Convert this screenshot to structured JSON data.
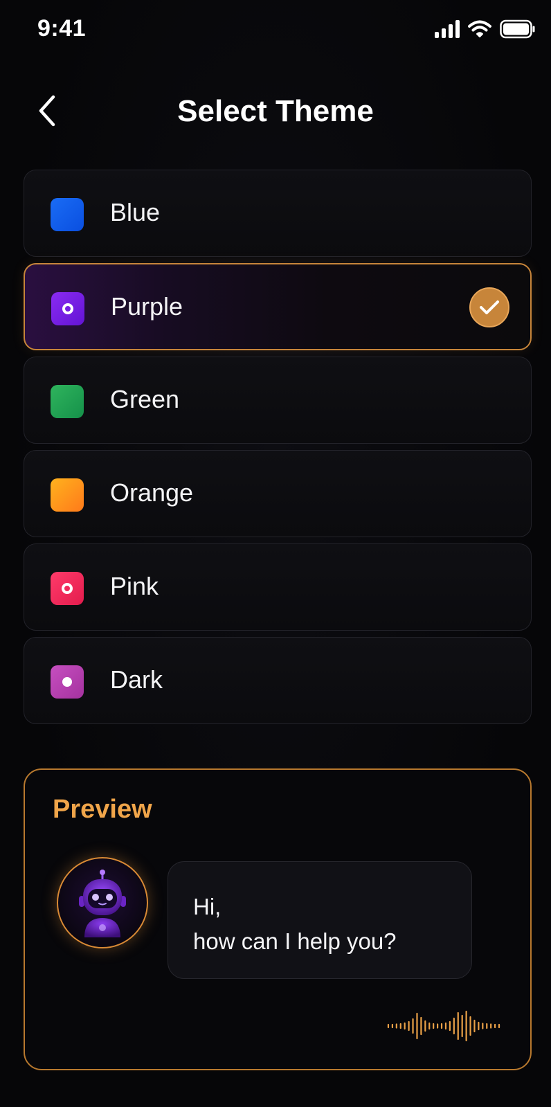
{
  "status_bar": {
    "time": "9:41"
  },
  "header": {
    "title": "Select Theme"
  },
  "themes": [
    {
      "label": "Blue",
      "color": "#1a6cf5",
      "color2": "#0a4fe0",
      "marker": "none",
      "selected": false
    },
    {
      "label": "Purple",
      "color": "#8a2bf2",
      "color2": "#6314d4",
      "marker": "ring",
      "selected": true
    },
    {
      "label": "Green",
      "color": "#2fb45d",
      "color2": "#15914a",
      "marker": "none",
      "selected": false
    },
    {
      "label": "Orange",
      "color": "#ffb21e",
      "color2": "#ff7a1a",
      "marker": "none",
      "selected": false
    },
    {
      "label": "Pink",
      "color": "#ff3b6a",
      "color2": "#e31c4d",
      "marker": "ring",
      "selected": false
    },
    {
      "label": "Dark",
      "color": "#c64fc0",
      "color2": "#a5329f",
      "marker": "dot",
      "selected": false
    }
  ],
  "preview": {
    "title": "Preview",
    "message_line1": "Hi,",
    "message_line2": "how can I help you?"
  },
  "colors": {
    "accent": "#c7853a",
    "preview_title": "#f0a54a",
    "background": "#060608"
  },
  "icons": {
    "back": "chevron-left-icon",
    "selected": "checkmark-icon",
    "avatar": "robot-icon",
    "waveform": "audio-waveform-icon"
  }
}
